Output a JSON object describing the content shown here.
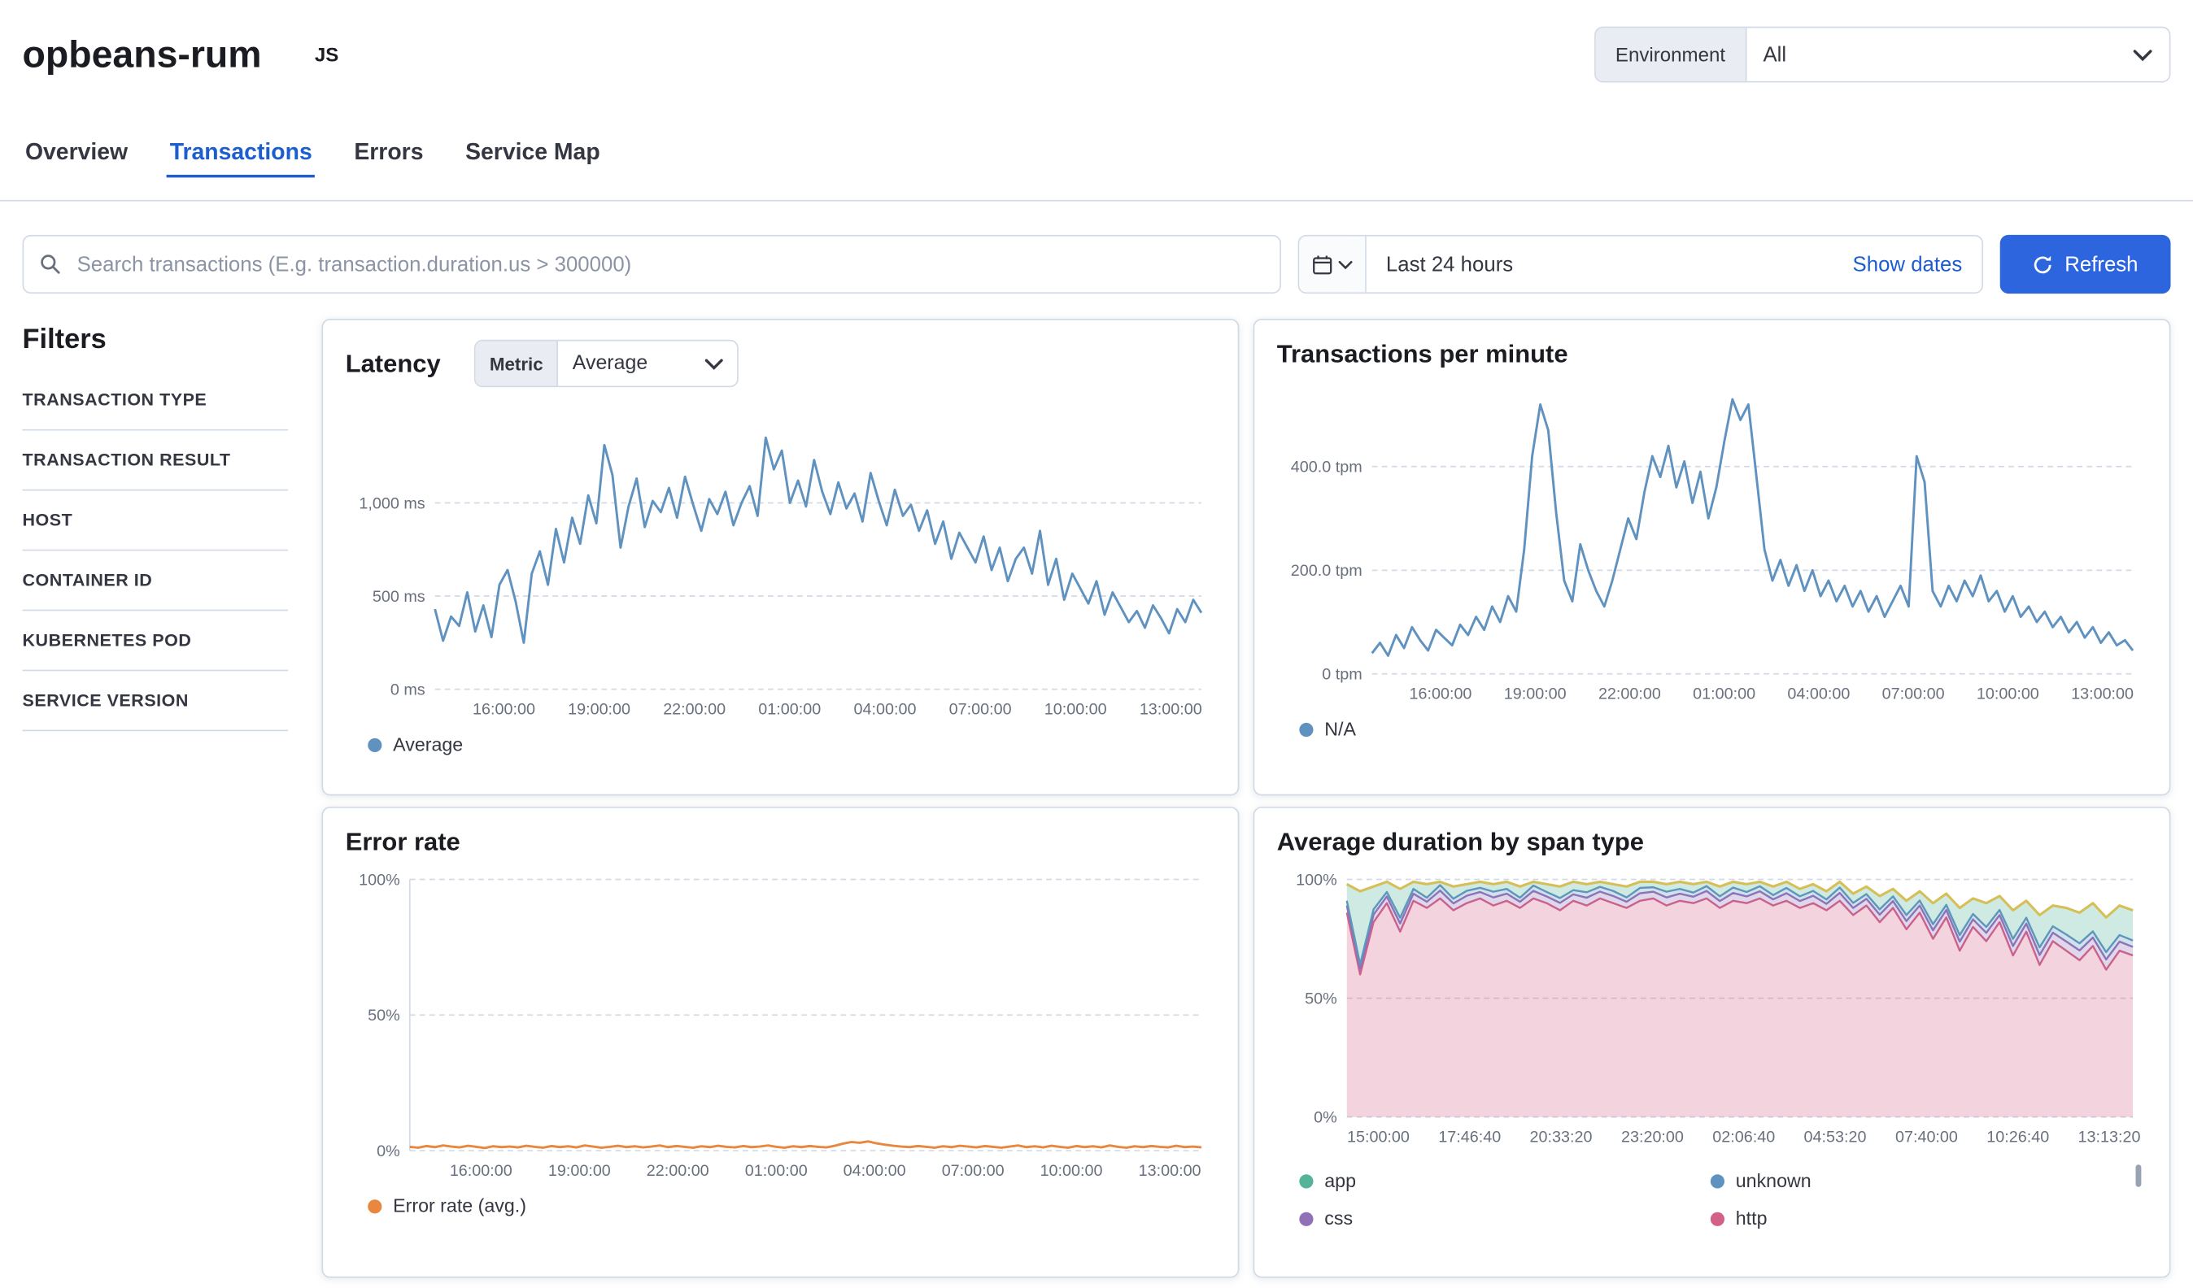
{
  "colors": {
    "primary_button": "#2D65DF",
    "link": "#1C5DD0"
  },
  "header": {
    "service_name": "opbeans-rum",
    "agent_badge": "JS",
    "environment_label": "Environment",
    "environment_value": "All"
  },
  "tabs": [
    {
      "label": "Overview",
      "active": false
    },
    {
      "label": "Transactions",
      "active": true
    },
    {
      "label": "Errors",
      "active": false
    },
    {
      "label": "Service Map",
      "active": false
    }
  ],
  "search": {
    "placeholder": "Search transactions (E.g. transaction.duration.us > 300000)"
  },
  "datepicker": {
    "quick_value": "Last 24 hours",
    "show_dates_label": "Show dates",
    "refresh_label": "Refresh"
  },
  "filters": {
    "title": "Filters",
    "items": [
      "TRANSACTION TYPE",
      "TRANSACTION RESULT",
      "HOST",
      "CONTAINER ID",
      "KUBERNETES POD",
      "SERVICE VERSION"
    ]
  },
  "panels": {
    "latency": {
      "title": "Latency",
      "metric_label": "Metric",
      "metric_value": "Average",
      "legend": [
        {
          "label": "Average",
          "color": "#6092C0"
        }
      ]
    },
    "tpm": {
      "title": "Transactions per minute",
      "legend": [
        {
          "label": "N/A",
          "color": "#6092C0"
        }
      ]
    },
    "error_rate": {
      "title": "Error rate",
      "legend": [
        {
          "label": "Error rate (avg.)",
          "color": "#E8873F"
        }
      ]
    },
    "span_duration": {
      "title": "Average duration by span type",
      "legend": [
        {
          "label": "app",
          "color": "#54B399"
        },
        {
          "label": "css",
          "color": "#9170B8"
        },
        {
          "label": "unknown",
          "color": "#6092C0"
        },
        {
          "label": "http",
          "color": "#D36086"
        }
      ]
    }
  },
  "chart_data": [
    {
      "id": "latency",
      "type": "line",
      "title": "Latency",
      "ylabel": "ms",
      "ylim": [
        0,
        1500
      ],
      "grid": true,
      "legend_position": "bottom",
      "yticks": {
        "values": [
          0,
          500,
          1000
        ],
        "labels": [
          "0 ms",
          "500 ms",
          "1,000 ms"
        ]
      },
      "xticklabels": [
        "16:00:00",
        "19:00:00",
        "22:00:00",
        "01:00:00",
        "04:00:00",
        "07:00:00",
        "10:00:00",
        "13:00:00"
      ],
      "tick_span": [
        0.09,
        0.96
      ],
      "margin_left": 64,
      "series": [
        {
          "name": "Average",
          "color": "#6092C0",
          "values": [
            430,
            260,
            390,
            340,
            520,
            310,
            450,
            280,
            560,
            640,
            470,
            250,
            620,
            740,
            560,
            860,
            680,
            920,
            780,
            1040,
            890,
            1310,
            1150,
            760,
            980,
            1130,
            870,
            1010,
            950,
            1080,
            920,
            1140,
            990,
            850,
            1020,
            940,
            1060,
            880,
            1000,
            1090,
            930,
            1350,
            1180,
            1280,
            1000,
            1120,
            980,
            1230,
            1060,
            940,
            1110,
            970,
            1050,
            900,
            1160,
            1010,
            880,
            1070,
            930,
            990,
            850,
            960,
            780,
            900,
            700,
            840,
            760,
            680,
            820,
            640,
            760,
            580,
            700,
            760,
            620,
            850,
            560,
            700,
            480,
            620,
            540,
            460,
            580,
            400,
            520,
            440,
            360,
            420,
            330,
            450,
            380,
            300,
            430,
            360,
            480,
            410
          ]
        }
      ]
    },
    {
      "id": "tpm",
      "type": "line",
      "title": "Transactions per minute",
      "ylabel": "tpm",
      "ylim": [
        0,
        545
      ],
      "grid": true,
      "legend_position": "bottom",
      "yticks": {
        "values": [
          0,
          200,
          400
        ],
        "labels": [
          "0 tpm",
          "200.0 tpm",
          "400.0 tpm"
        ]
      },
      "xticklabels": [
        "16:00:00",
        "19:00:00",
        "22:00:00",
        "01:00:00",
        "04:00:00",
        "07:00:00",
        "10:00:00",
        "13:00:00"
      ],
      "tick_span": [
        0.09,
        0.96
      ],
      "margin_left": 68,
      "series": [
        {
          "name": "N/A",
          "color": "#6092C0",
          "values": [
            40,
            60,
            35,
            75,
            50,
            90,
            65,
            45,
            85,
            70,
            55,
            95,
            75,
            110,
            85,
            130,
            100,
            150,
            120,
            240,
            420,
            520,
            470,
            310,
            180,
            140,
            250,
            200,
            160,
            130,
            180,
            240,
            300,
            260,
            350,
            420,
            380,
            440,
            360,
            410,
            330,
            390,
            300,
            360,
            450,
            530,
            490,
            520,
            380,
            240,
            180,
            220,
            170,
            210,
            160,
            200,
            150,
            180,
            140,
            170,
            130,
            160,
            120,
            150,
            110,
            140,
            170,
            130,
            420,
            370,
            160,
            130,
            170,
            140,
            180,
            150,
            190,
            140,
            160,
            120,
            150,
            110,
            130,
            100,
            120,
            90,
            110,
            80,
            100,
            70,
            90,
            60,
            80,
            55,
            65,
            45
          ]
        }
      ]
    },
    {
      "id": "error_rate",
      "type": "line",
      "title": "Error rate",
      "ylabel": "%",
      "ylim": [
        0,
        100
      ],
      "grid": true,
      "legend_position": "bottom",
      "yaxis_line": true,
      "yticks": {
        "values": [
          0,
          50,
          100
        ],
        "labels": [
          "0%",
          "50%",
          "100%"
        ]
      },
      "xticklabels": [
        "16:00:00",
        "19:00:00",
        "22:00:00",
        "01:00:00",
        "04:00:00",
        "07:00:00",
        "10:00:00",
        "13:00:00"
      ],
      "tick_span": [
        0.09,
        0.96
      ],
      "margin_left": 46,
      "series": [
        {
          "name": "Error rate (avg.)",
          "color": "#E8873F",
          "values": [
            1.4,
            1.1,
            1.7,
            1.3,
            1.9,
            1.5,
            1.2,
            1.8,
            1.4,
            1.0,
            1.6,
            1.3,
            1.5,
            1.2,
            1.8,
            1.4,
            1.1,
            1.7,
            1.3,
            1.6,
            1.2,
            1.9,
            1.5,
            1.1,
            1.4,
            1.8,
            1.3,
            1.6,
            1.2,
            1.5,
            1.9,
            1.3,
            1.7,
            1.4,
            1.1,
            1.6,
            1.3,
            1.8,
            1.4,
            1.2,
            1.7,
            1.3,
            1.5,
            1.9,
            1.4,
            1.1,
            1.6,
            1.3,
            1.7,
            1.4,
            1.2,
            1.8,
            2.6,
            3.2,
            2.9,
            3.4,
            2.7,
            2.2,
            1.8,
            1.5,
            1.3,
            1.7,
            1.4,
            1.1,
            1.6,
            1.3,
            1.8,
            1.5,
            1.2,
            1.7,
            1.4,
            1.1,
            1.5,
            1.9,
            1.3,
            1.6,
            1.2,
            1.8,
            1.4,
            1.1,
            1.7,
            1.3,
            1.6,
            1.2,
            1.9,
            1.4,
            1.1,
            1.6,
            1.3,
            1.7,
            1.4,
            1.2,
            1.8,
            1.3,
            1.5,
            1.2
          ]
        }
      ]
    },
    {
      "id": "span_duration",
      "type": "stacked_area",
      "title": "Average duration by span type",
      "ylabel": "%",
      "ylim": [
        0,
        100
      ],
      "grid": true,
      "legend_position": "bottom",
      "top_line_color": "#D6BF57",
      "yticks": {
        "values": [
          0,
          50,
          100
        ],
        "labels": [
          "0%",
          "50%",
          "100%"
        ]
      },
      "xticklabels": [
        "15:00:00",
        "17:46:40",
        "20:33:20",
        "23:20:00",
        "02:06:40",
        "04:53:20",
        "07:40:00",
        "10:26:40",
        "13:13:20"
      ],
      "tick_span": [
        0.04,
        0.97
      ],
      "margin_left": 50,
      "series": [
        {
          "name": "http",
          "color": "#D36086",
          "values": [
            86,
            60,
            82,
            90,
            78,
            91,
            88,
            92,
            87,
            90,
            92,
            89,
            91,
            88,
            92,
            90,
            87,
            91,
            89,
            92,
            90,
            88,
            91,
            92,
            89,
            91,
            90,
            92,
            88,
            91,
            90,
            92,
            89,
            91,
            88,
            90,
            87,
            91,
            85,
            89,
            82,
            88,
            79,
            86,
            75,
            84,
            70,
            80,
            74,
            82,
            68,
            78,
            64,
            74,
            70,
            66,
            72,
            62,
            70,
            68
          ]
        },
        {
          "name": "css",
          "color": "#9170B8",
          "values": [
            3.0,
            2.5,
            3.2,
            2.8,
            3.5,
            3.0,
            2.6,
            3.3,
            2.9,
            3.1,
            2.7,
            3.4,
            3.0,
            2.6,
            3.2,
            2.8,
            3.1,
            2.7,
            3.3,
            2.9,
            3.0,
            2.6,
            3.2,
            2.8,
            3.4,
            3.0,
            2.7,
            3.1,
            2.9,
            3.3,
            2.8,
            3.0,
            2.6,
            3.2,
            2.9,
            3.1,
            2.7,
            3.3,
            3.0,
            2.8,
            3.2,
            2.9,
            3.5,
            3.0,
            3.6,
            3.1,
            3.8,
            3.2,
            3.5,
            3.0,
            4.0,
            3.4,
            4.2,
            3.6,
            3.9,
            4.1,
            3.5,
            4.3,
            3.8,
            3.6
          ]
        },
        {
          "name": "unknown",
          "color": "#6092C0",
          "values": [
            2.0,
            1.8,
            2.2,
            1.9,
            2.4,
            2.0,
            1.7,
            2.3,
            2.0,
            2.1,
            1.8,
            2.4,
            2.0,
            1.7,
            2.2,
            1.9,
            2.1,
            1.8,
            2.3,
            2.0,
            2.1,
            1.8,
            2.2,
            1.9,
            2.4,
            2.0,
            1.8,
            2.1,
            2.0,
            2.3,
            1.9,
            2.1,
            1.8,
            2.2,
            2.0,
            2.1,
            1.9,
            2.3,
            2.1,
            2.0,
            2.2,
            2.0,
            2.5,
            2.1,
            2.6,
            2.2,
            2.8,
            2.3,
            2.5,
            2.2,
            3.0,
            2.5,
            3.2,
            2.7,
            2.9,
            3.0,
            2.6,
            3.1,
            2.8,
            2.7
          ]
        },
        {
          "name": "app",
          "color": "#54B399",
          "values": [
            7.0,
            30.7,
            9.6,
            4.3,
            12.1,
            3.0,
            5.7,
            1.4,
            5.1,
            2.8,
            2.5,
            3.2,
            3.0,
            4.7,
            1.6,
            3.3,
            4.8,
            3.5,
            3.4,
            2.1,
            2.9,
            4.6,
            2.6,
            2.3,
            3.2,
            3.0,
            3.5,
            1.8,
            4.1,
            2.4,
            3.3,
            1.9,
            3.6,
            2.6,
            3.1,
            2.8,
            3.4,
            2.4,
            3.9,
            3.2,
            5.6,
            3.1,
            6.0,
            3.9,
            8.8,
            4.7,
            11.4,
            6.5,
            10.0,
            5.8,
            12.0,
            7.1,
            13.6,
            8.7,
            11.2,
            12.9,
            11.9,
            14.6,
            12.4,
            12.7
          ]
        }
      ]
    }
  ]
}
